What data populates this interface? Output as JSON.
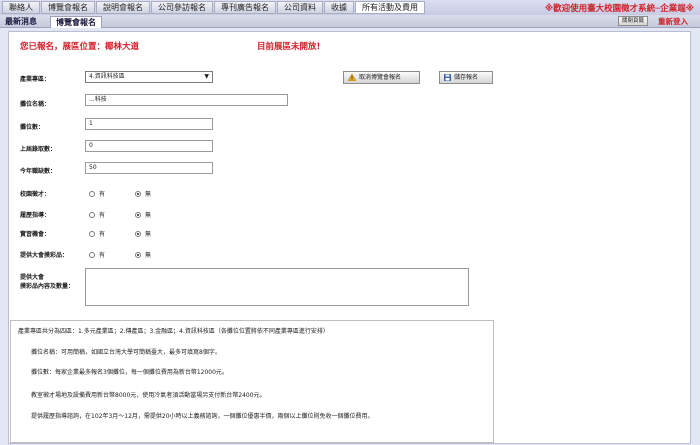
{
  "nav": [
    "聯絡人",
    "博覽會報名",
    "說明會報名",
    "公司參訪報名",
    "專刊廣告報名",
    "公司資料",
    "收據",
    "所有活動及費用"
  ],
  "welcome": "※歡迎使用臺大校園徵才系統─企業端※",
  "tabs": {
    "news": "最新消息",
    "expo": "博覽會報名"
  },
  "close_button": "關閉頁籤",
  "relogin": "重新登入",
  "status": {
    "registered": "您已報名，展區位置：椰林大道",
    "zone_closed": "目前展區未開放!"
  },
  "form": {
    "industry_label": "產業專區：",
    "industry_value": "4.資訊科技區",
    "cancel_button": "取消博覽會報名",
    "save_button": "儲存報名",
    "booth_name_label": "攤位名稱：",
    "booth_name_value": "...科技",
    "booth_count_label": "攤位數：",
    "booth_count_value": "1",
    "last_year_hires_label": "上屆錄取數：",
    "last_year_hires_value": "0",
    "vacancies_label": "今年職缺數：",
    "vacancies_value": "50",
    "campus_recruit_label": "校園徵才：",
    "resume_label": "履歷指導：",
    "internship_label": "實習機會：",
    "prize_label": "提供大會摸彩品：",
    "prize_desc_label_1": "提供大會",
    "prize_desc_label_2": "摸彩品內容及數量：",
    "yes": "有",
    "no": "無"
  },
  "info": [
    "產業專區共分為四區：1.多元產業區；2.傳產區；3.金融區；4.資訊科技區（各攤位位置將依不同產業專區進行安排）",
    "攤位名稱：可用簡稱，如國立台灣大學可簡稱臺大，最多可填寫8個字。",
    "攤位數：每家企業最多報名3個攤位，每一個攤位費用為新台幣12000元。",
    "教室徵才場地及設備費用新台幣8000元，使用冷氣者須活動當場另支付新台幣2400元。",
    "提供履歷指導諮詢，在102年3月～12月，需提供20小時以上義務諮詢，一個攤位優惠半價，兩個以上攤位則免收一個攤位費用。"
  ],
  "colors": {
    "accent_red": "#d2202a",
    "nav_bg": "#c7cbe3"
  }
}
